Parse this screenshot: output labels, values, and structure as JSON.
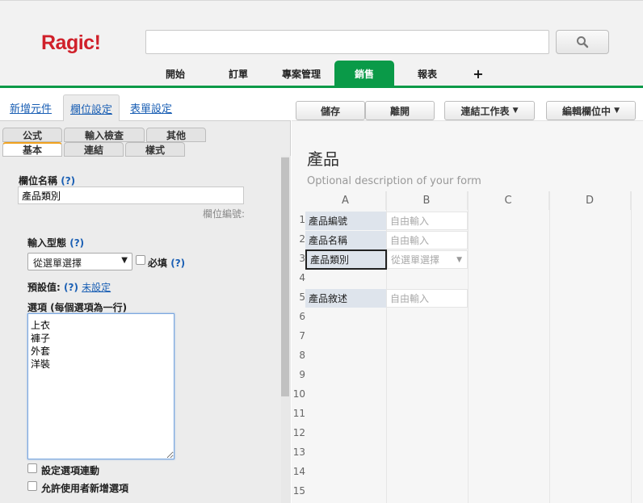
{
  "app": {
    "logo": "Ragic!"
  },
  "search": {
    "placeholder": ""
  },
  "nav": {
    "tabs": [
      {
        "label": "開始"
      },
      {
        "label": "訂單"
      },
      {
        "label": "專案管理"
      },
      {
        "label": "銷售",
        "active": true
      },
      {
        "label": "報表"
      }
    ],
    "add_label": "+"
  },
  "left": {
    "tabs": {
      "new_element": "新增元件",
      "field_settings": "欄位設定",
      "form_settings": "表單設定"
    },
    "subtabs": {
      "formula": "公式",
      "validation": "輸入檢查",
      "other": "其他",
      "basic": "基本",
      "link": "連結",
      "style": "樣式"
    },
    "field_name_label": "欄位名稱",
    "help": "(?)",
    "field_name_value": "產品類別",
    "field_number_label": "欄位編號:",
    "input_type_label": "輸入型態",
    "input_type_value": "從選單選擇",
    "required_label": "必填",
    "default_label": "預設值:",
    "default_value": "未設定",
    "options_label": "選項 (每個選項為一行)",
    "options": "上衣\n褲子\n外套\n洋裝",
    "option_link_label": "設定選項連動",
    "allow_new_label": "允許使用者新增選項"
  },
  "toolbar": {
    "save": "儲存",
    "leave": "離開",
    "link_sheet": "連結工作表",
    "edit_field": "編輯欄位中"
  },
  "sheet": {
    "title": "產品",
    "description": "Optional description of your form",
    "columns": [
      "A",
      "B",
      "C",
      "D"
    ],
    "rows": [
      "1",
      "2",
      "3",
      "4",
      "5",
      "6",
      "7",
      "8",
      "9",
      "10",
      "11",
      "12",
      "13",
      "14",
      "15"
    ],
    "fields": [
      {
        "label": "產品編號",
        "placeholder": "自由輸入"
      },
      {
        "label": "產品名稱",
        "placeholder": "自由輸入"
      },
      {
        "label": "產品類別",
        "placeholder": "從選單選擇"
      },
      {
        "label": "產品敘述",
        "placeholder": "自由輸入"
      }
    ]
  },
  "colors": {
    "brand": "#d0202a",
    "accent": "#0a9a48",
    "link": "#1a5fb4",
    "selected_tab_top": "#f1a21e"
  }
}
